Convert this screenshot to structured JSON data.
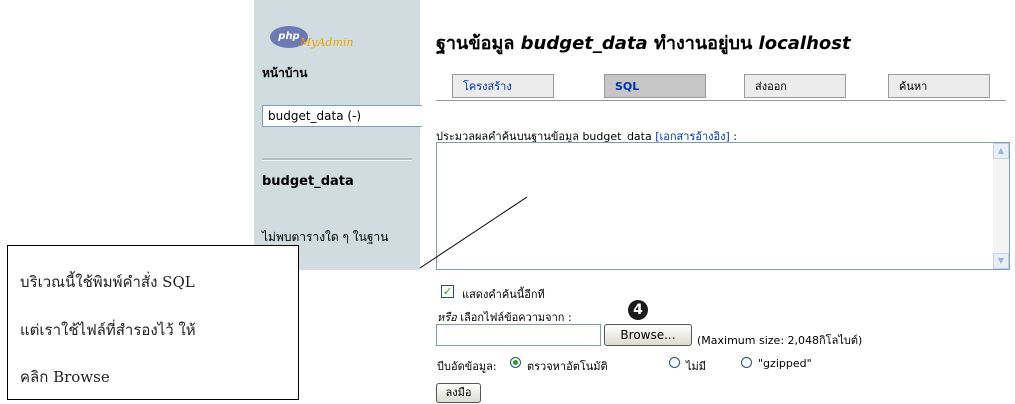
{
  "sidebar": {
    "logo_php": "php",
    "logo_my": "MyAdmin",
    "home_label": "หน้าบ้าน",
    "db_select_value": "budget_data (-)",
    "db_name": "budget_data",
    "no_tables_text": "ไม่พบตารางใด ๆ ในฐาน"
  },
  "header": {
    "title_prefix": "ฐานข้อมูล",
    "db_name": "budget_data",
    "title_middle": "ทำงานอยู่บน",
    "host": "localhost"
  },
  "tabs": [
    {
      "label": "โครงสร้าง"
    },
    {
      "label": "SQL"
    },
    {
      "label": "ส่งออก"
    },
    {
      "label": "ค้นหา"
    }
  ],
  "query": {
    "label_prefix": "ประมวลผลคำค้นบนฐานข้อมูล budget_data",
    "doc_link": "[เอกสารอ้างอิง]",
    "label_suffix": ":",
    "show_again_label": "แสดงคำค้นนี้อีกที"
  },
  "import": {
    "or_label": "หรือ",
    "file_label": "เลือกไฟล์ข้อความจาก :",
    "browse_label": "Browse...",
    "max_size": "(Maximum size: 2,048กิโลไบต์)",
    "step_badge": "4",
    "compression_label": "บีบอัดข้อมูล:",
    "options": [
      "ตรวจหาอัตโนมัติ",
      "ไม่มี",
      "\"gzipped\""
    ],
    "go_label": "ลงมือ"
  },
  "callout": {
    "line1": "บริเวณนี้ใช้พิมพ์คำสั่ง  SQL",
    "line2": "แต่เราใช้ไฟล์ที่สำรองไว้ ให้",
    "line3": "คลิก Browse"
  }
}
